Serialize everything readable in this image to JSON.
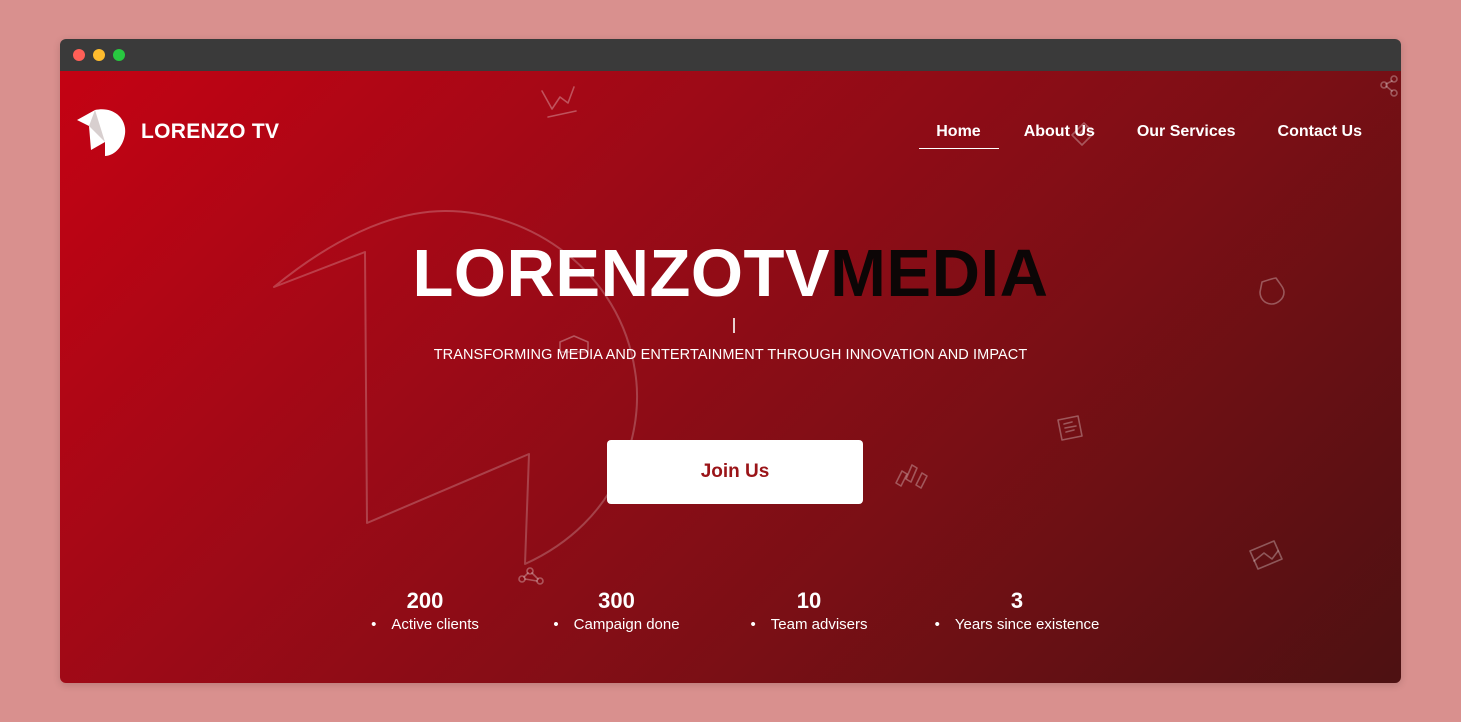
{
  "brand": {
    "name": "LORENZO TV",
    "logo_icon": "lorenzo-flag-logo-icon"
  },
  "nav": {
    "items": [
      {
        "label": "Home",
        "active": true
      },
      {
        "label": "About Us",
        "active": false
      },
      {
        "label": "Our Services",
        "active": false
      },
      {
        "label": "Contact Us",
        "active": false
      }
    ]
  },
  "hero": {
    "headline_light": "LORENZOTV",
    "headline_dark": "MEDIA",
    "tagline": "TRANSFORMING MEDIA AND ENTERTAINMENT THROUGH INNOVATION AND IMPACT",
    "cta_label": "Join Us"
  },
  "stats": [
    {
      "value": "200",
      "label": "Active clients"
    },
    {
      "value": "300",
      "label": "Campaign done"
    },
    {
      "value": "10",
      "label": "Team advisers"
    },
    {
      "value": "3",
      "label": "Years since existence"
    }
  ],
  "colors": {
    "page_background": "#d9908e",
    "hero_gradient_start": "#c40213",
    "hero_gradient_end": "#4d1112",
    "cta_text": "#9a1418",
    "titlebar": "#3a3a3a"
  },
  "decor_icons": [
    "chart-line-icon",
    "share-nodes-icon",
    "badge-icon",
    "newspaper-icon",
    "bar-chart-icon",
    "envelope-icon",
    "shield-icon"
  ]
}
